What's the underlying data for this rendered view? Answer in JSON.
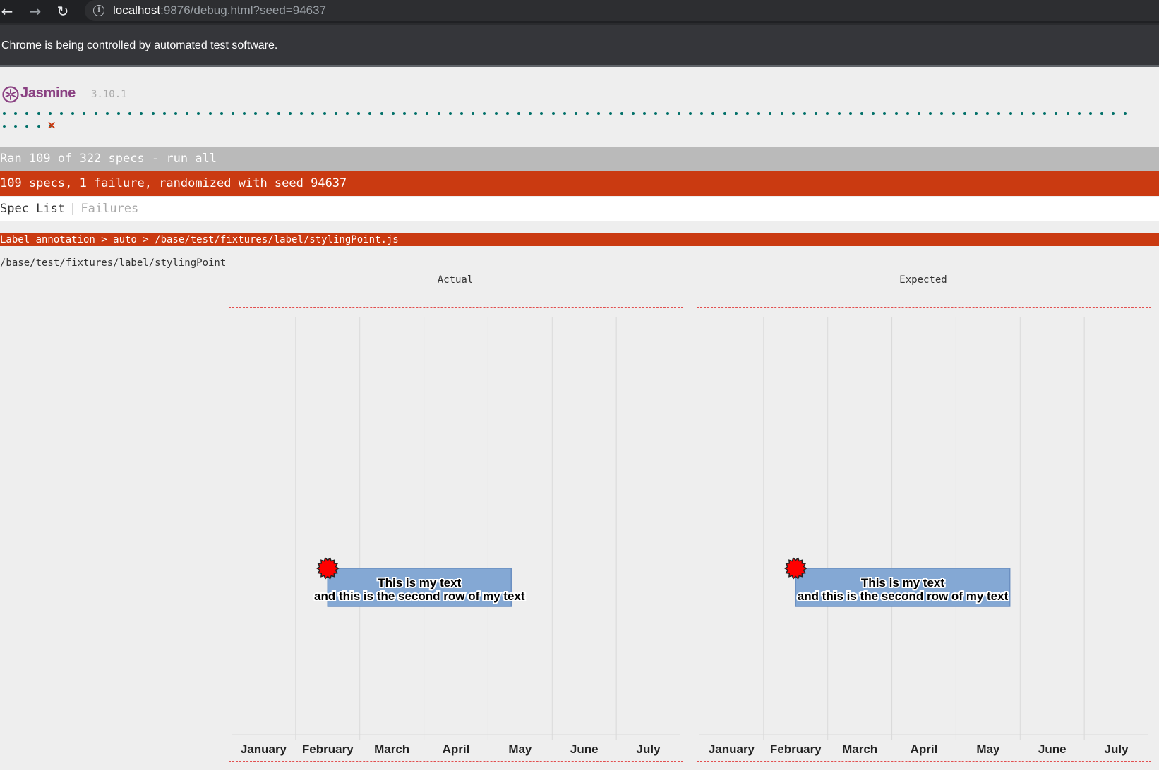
{
  "browser": {
    "url_host": "localhost",
    "url_rest": ":9876/debug.html?seed=94637",
    "infobar": "Chrome is being controlled by automated test software."
  },
  "jasmine": {
    "title": "Jasmine",
    "version": "3.10.1",
    "passed_dots": 104,
    "failed_mark": "×",
    "ran_bar": "Ran 109 of 322 specs - run all",
    "failure_bar": "109 specs, 1 failure, randomized with seed 94637",
    "menu": {
      "spec_list": "Spec List",
      "separator": "|",
      "failures": "Failures"
    },
    "failing_spec": "Label annotation > auto > /base/test/fixtures/label/stylingPoint.js",
    "fixture_path": "/base/test/fixtures/label/stylingPoint",
    "colors": {
      "passed": "#007069",
      "failed": "#ca3a11",
      "skipped": "#bababa",
      "brand": "#8a4182"
    }
  },
  "panels": [
    {
      "label": "Actual",
      "chart": {
        "months": [
          "January",
          "February",
          "March",
          "April",
          "May",
          "June",
          "July"
        ],
        "annotation": {
          "line1": "This is my text",
          "line2": "and this is the second row of my text",
          "box_color": "#84a8d4",
          "point_color": "#ff0000"
        }
      }
    },
    {
      "label": "Expected",
      "chart": {
        "months": [
          "January",
          "February",
          "March",
          "April",
          "May",
          "June",
          "July"
        ],
        "annotation": {
          "line1": "This is my text",
          "line2": "and this is the second row of my text",
          "box_color": "#84a8d4",
          "point_color": "#ff0000"
        }
      }
    }
  ]
}
